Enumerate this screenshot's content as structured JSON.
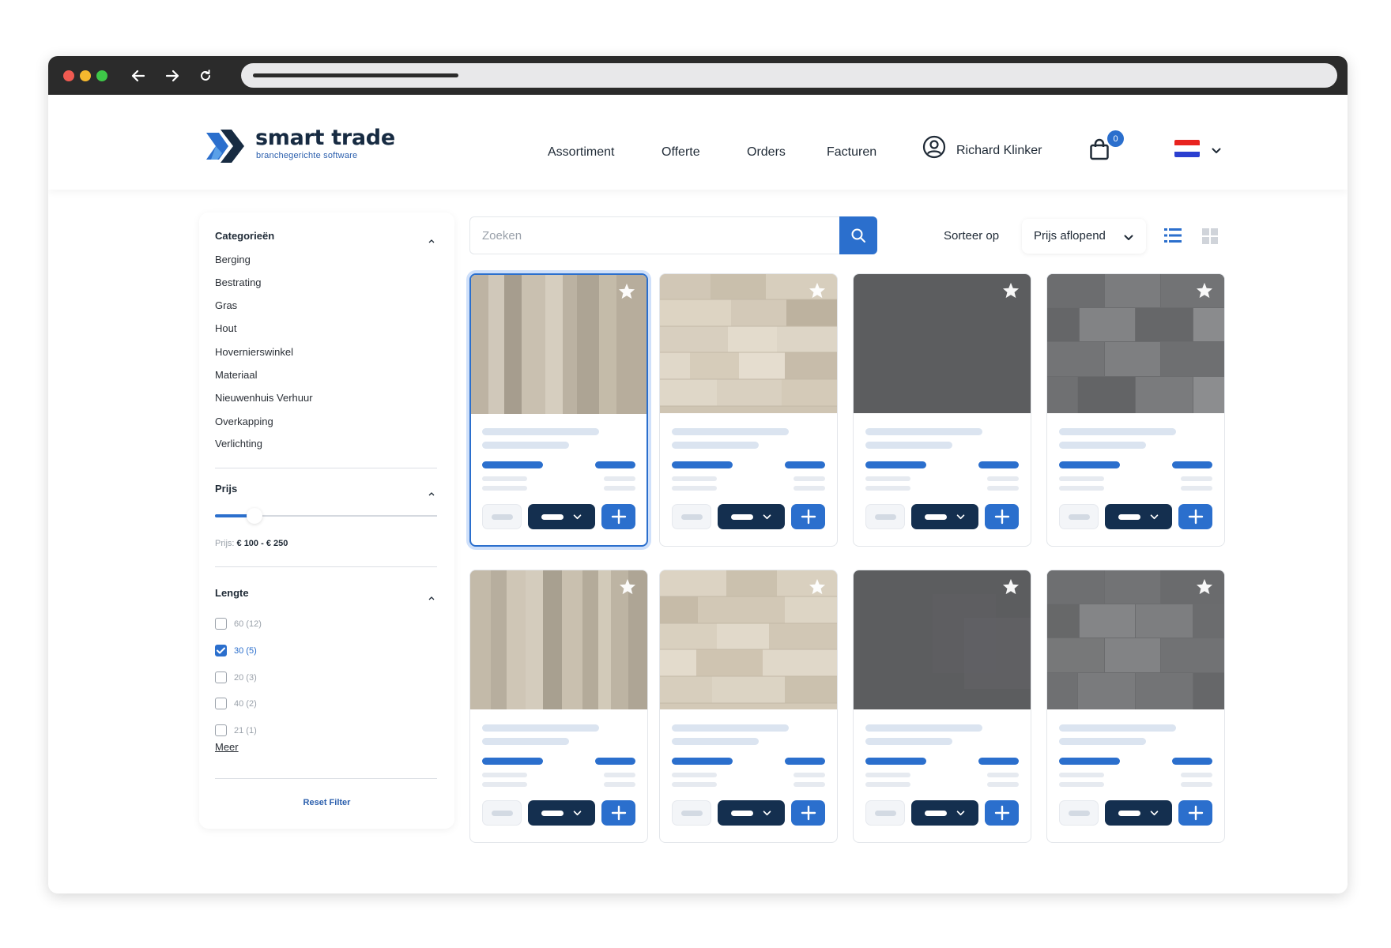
{
  "brand": {
    "name": "smart trade",
    "tagline": "branchegerichte software"
  },
  "nav": {
    "items": [
      "Assortiment",
      "Offerte",
      "Orders",
      "Facturen"
    ]
  },
  "user": {
    "name": "Richard Klinker"
  },
  "cart": {
    "count": "0"
  },
  "language": {
    "flag": "netherlands-flag-icon",
    "colors": [
      "#e8231f",
      "#ffffff",
      "#2b3fd0"
    ]
  },
  "filters": {
    "categories": {
      "title": "Categorieën",
      "items": [
        "Berging",
        "Bestrating",
        "Gras",
        "Hout",
        "Hovernierswinkel",
        "Materiaal",
        "Nieuwenhuis Verhuur",
        "Overkapping",
        "Verlichting"
      ]
    },
    "price": {
      "title": "Prijs",
      "label": "Prijs:",
      "range": "€ 100 - € 250",
      "slider_fill_percent": 16
    },
    "length": {
      "title": "Lengte",
      "options": [
        {
          "label": "60 (12)",
          "checked": false
        },
        {
          "label": "30 (5)",
          "checked": true
        },
        {
          "label": "20 (3)",
          "checked": false
        },
        {
          "label": "40 (2)",
          "checked": false
        },
        {
          "label": "21 (1)",
          "checked": false
        }
      ],
      "more": "Meer"
    },
    "reset": "Reset Filter"
  },
  "search": {
    "placeholder": "Zoeken"
  },
  "sort": {
    "label": "Sorteer op",
    "value": "Prijs aflopend"
  },
  "view": {
    "active": "list-view-icon"
  },
  "products": [
    {
      "texture": "wood-planks",
      "selected": true
    },
    {
      "texture": "sandstone-tiles",
      "selected": false
    },
    {
      "texture": "dark-slate",
      "selected": false
    },
    {
      "texture": "grey-bricks",
      "selected": false
    },
    {
      "texture": "wood-planks",
      "selected": false
    },
    {
      "texture": "sandstone-tiles",
      "selected": false
    },
    {
      "texture": "dark-slate",
      "selected": false
    },
    {
      "texture": "grey-bricks",
      "selected": false
    }
  ],
  "colors": {
    "accent": "#2b6fcd",
    "dark_button": "#142f4f",
    "brand_dark": "#172b42"
  }
}
